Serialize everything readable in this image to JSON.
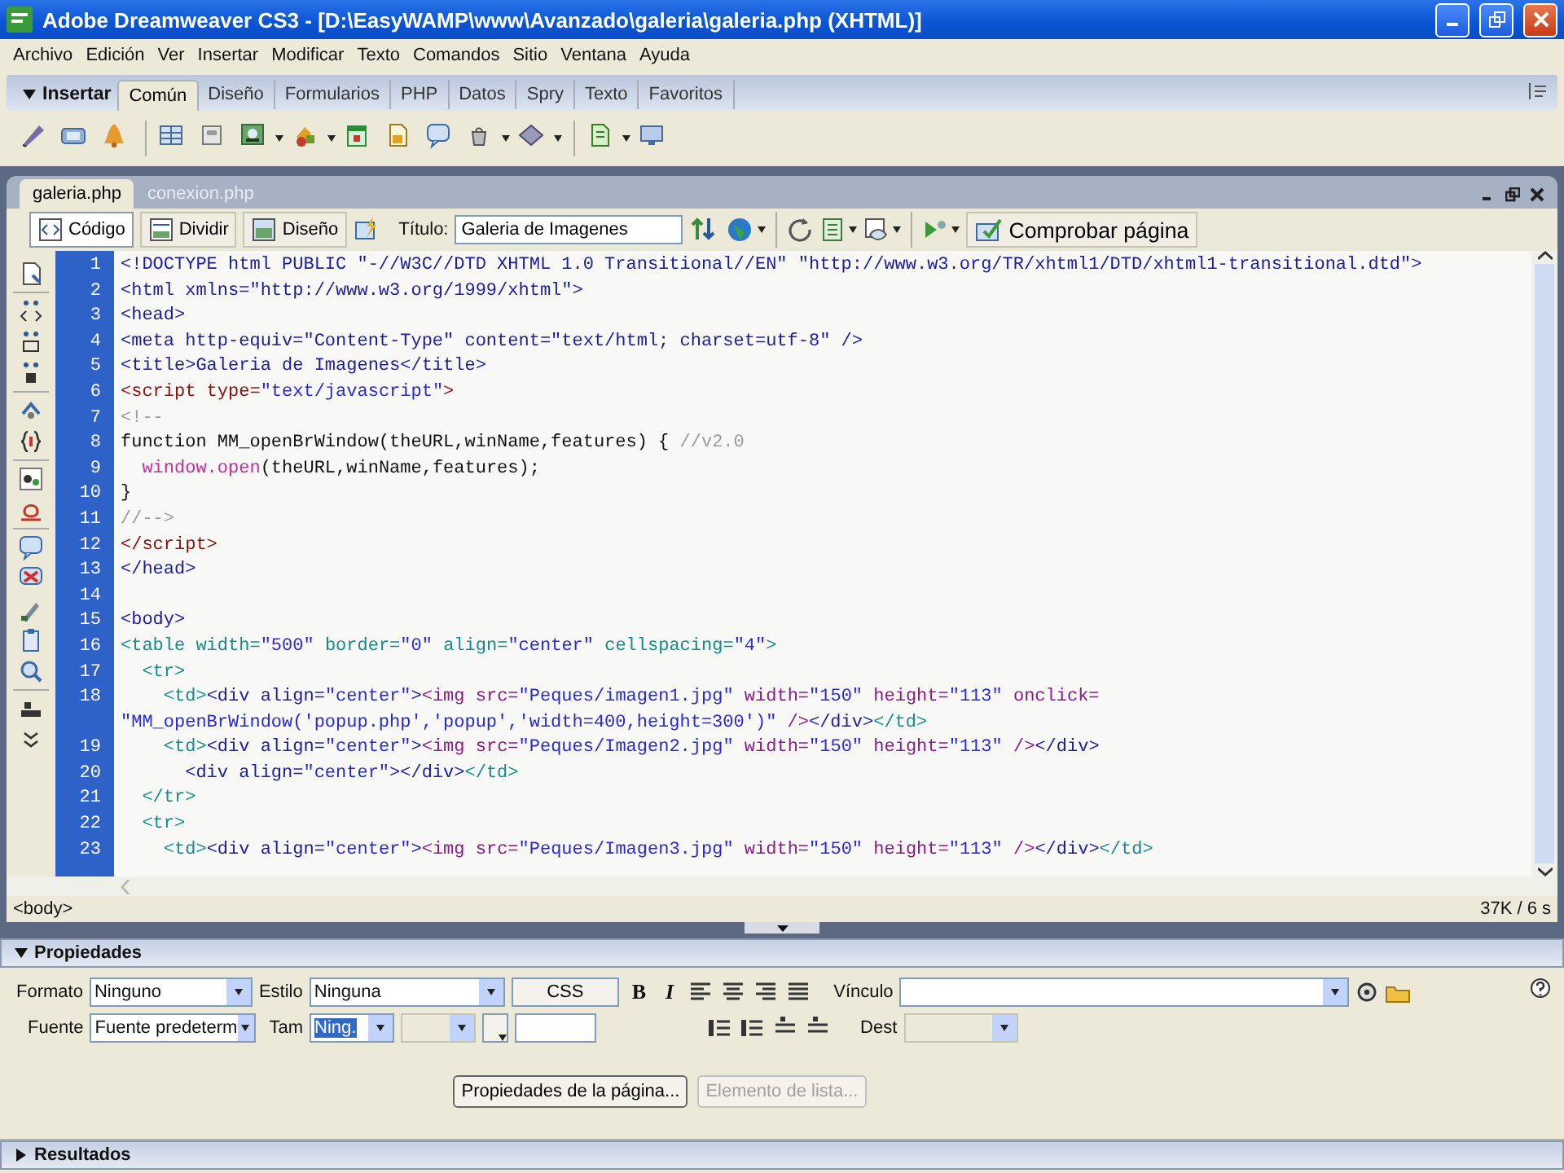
{
  "window": {
    "title": "Adobe Dreamweaver CS3 - [D:\\EasyWAMP\\www\\Avanzado\\galeria\\galeria.php (XHTML)]"
  },
  "menu": [
    "Archivo",
    "Edición",
    "Ver",
    "Insertar",
    "Modificar",
    "Texto",
    "Comandos",
    "Sitio",
    "Ventana",
    "Ayuda"
  ],
  "insert_bar": {
    "title": "Insertar",
    "expanded": true,
    "tabs": [
      {
        "label": "Común",
        "selected": true
      },
      {
        "label": "Diseño",
        "selected": false
      },
      {
        "label": "Formularios",
        "selected": false
      },
      {
        "label": "PHP",
        "selected": false
      },
      {
        "label": "Datos",
        "selected": false
      },
      {
        "label": "Spry",
        "selected": false
      },
      {
        "label": "Texto",
        "selected": false
      },
      {
        "label": "Favoritos",
        "selected": false
      }
    ]
  },
  "document_tabs": [
    {
      "label": "galeria.php",
      "selected": true
    },
    {
      "label": "conexion.php",
      "selected": false
    }
  ],
  "document_toolbar": {
    "views": [
      {
        "label": "Código",
        "selected": true
      },
      {
        "label": "Dividir",
        "selected": false
      },
      {
        "label": "Diseño",
        "selected": false
      }
    ],
    "title_label": "Título:",
    "title_value": "Galeria de Imagenes",
    "check_page": "Comprobar página"
  },
  "code": {
    "lines": [
      {
        "number": "1",
        "segments": [
          {
            "kind": "tag",
            "text": "<!DOCTYPE html PUBLIC \"-//W3C//DTD XHTML 1.0 Transitional//EN\" \"http://www.w3.org/TR/xhtml1/DTD/xhtml1-transitional.dtd\">"
          }
        ]
      },
      {
        "number": "2",
        "segments": [
          {
            "kind": "tag",
            "text": "<html xmlns=\"http://www.w3.org/1999/xhtml\">"
          }
        ]
      },
      {
        "number": "3",
        "segments": [
          {
            "kind": "tag",
            "text": "<head>"
          }
        ]
      },
      {
        "number": "4",
        "segments": [
          {
            "kind": "tag",
            "text": "<meta http-equiv=\"Content-Type\" content=\"text/html; charset=utf-8\" />"
          }
        ]
      },
      {
        "number": "5",
        "segments": [
          {
            "kind": "tag",
            "text": "<title>Galeria de Imagenes</title>"
          }
        ]
      },
      {
        "number": "6",
        "segments": [
          {
            "kind": "script",
            "text": "<script type="
          },
          {
            "kind": "value",
            "text": "\"text/javascript\""
          },
          {
            "kind": "script",
            "text": ">"
          }
        ]
      },
      {
        "number": "7",
        "segments": [
          {
            "kind": "comment",
            "text": "<!--"
          }
        ]
      },
      {
        "number": "8",
        "segments": [
          {
            "kind": "text",
            "text": "function MM_openBrWindow(theURL,winName,features) { "
          },
          {
            "kind": "comment",
            "text": "//v2.0"
          }
        ]
      },
      {
        "number": "9",
        "segments": [
          {
            "kind": "func",
            "text": "  window.open"
          },
          {
            "kind": "text",
            "text": "(theURL,winName,features);"
          }
        ]
      },
      {
        "number": "10",
        "segments": [
          {
            "kind": "text",
            "text": "}"
          }
        ]
      },
      {
        "number": "11",
        "segments": [
          {
            "kind": "comment",
            "text": "//-->"
          }
        ]
      },
      {
        "number": "12",
        "segments": [
          {
            "kind": "script",
            "text": "</script>"
          }
        ]
      },
      {
        "number": "13",
        "segments": [
          {
            "kind": "tag",
            "text": "</head>"
          }
        ]
      },
      {
        "number": "14"
      },
      {
        "number": "15",
        "segments": [
          {
            "kind": "tag",
            "text": "<body>"
          }
        ]
      },
      {
        "number": "16",
        "segments": [
          {
            "kind": "table",
            "text": "<table width="
          },
          {
            "kind": "value",
            "text": "\"500\""
          },
          {
            "kind": "table",
            "text": " border="
          },
          {
            "kind": "value",
            "text": "\"0\""
          },
          {
            "kind": "table",
            "text": " align="
          },
          {
            "kind": "value",
            "text": "\"center\""
          },
          {
            "kind": "table",
            "text": " cellspacing="
          },
          {
            "kind": "value",
            "text": "\"4\""
          },
          {
            "kind": "table",
            "text": ">"
          }
        ]
      },
      {
        "number": "17",
        "segments": [
          {
            "kind": "table",
            "text": "  <tr>"
          }
        ]
      },
      {
        "number": "18",
        "segments": [
          {
            "kind": "table",
            "text": "    <td>"
          },
          {
            "kind": "tag",
            "text": "<div align="
          },
          {
            "kind": "value",
            "text": "\"center\""
          },
          {
            "kind": "tag",
            "text": ">"
          },
          {
            "kind": "img",
            "text": "<img src="
          },
          {
            "kind": "value",
            "text": "\"Peques/imagen1.jpg\""
          },
          {
            "kind": "img",
            "text": " width="
          },
          {
            "kind": "value",
            "text": "\"150\""
          },
          {
            "kind": "img",
            "text": " height="
          },
          {
            "kind": "value",
            "text": "\"113\""
          },
          {
            "kind": "img",
            "text": " onclick="
          }
        ]
      },
      {
        "segments": [
          {
            "kind": "value",
            "text": "\"MM_openBrWindow('popup.php','popup','width=400,height=300')\""
          },
          {
            "kind": "img",
            "text": " />"
          },
          {
            "kind": "tag",
            "text": "</div>"
          },
          {
            "kind": "table",
            "text": "</td>"
          }
        ]
      },
      {
        "number": "19",
        "segments": [
          {
            "kind": "table",
            "text": "    <td>"
          },
          {
            "kind": "tag",
            "text": "<div align="
          },
          {
            "kind": "value",
            "text": "\"center\""
          },
          {
            "kind": "tag",
            "text": ">"
          },
          {
            "kind": "img",
            "text": "<img src="
          },
          {
            "kind": "value",
            "text": "\"Peques/Imagen2.jpg\""
          },
          {
            "kind": "img",
            "text": " width="
          },
          {
            "kind": "value",
            "text": "\"150\""
          },
          {
            "kind": "img",
            "text": " height="
          },
          {
            "kind": "value",
            "text": "\"113\""
          },
          {
            "kind": "img",
            "text": " />"
          },
          {
            "kind": "tag",
            "text": "</div>"
          }
        ]
      },
      {
        "number": "20",
        "segments": [
          {
            "kind": "tag",
            "text": "      <div align="
          },
          {
            "kind": "value",
            "text": "\"center\""
          },
          {
            "kind": "tag",
            "text": "></div>"
          },
          {
            "kind": "table",
            "text": "</td>"
          }
        ]
      },
      {
        "number": "21",
        "segments": [
          {
            "kind": "table",
            "text": "  </tr>"
          }
        ]
      },
      {
        "number": "22",
        "segments": [
          {
            "kind": "table",
            "text": "  <tr>"
          }
        ]
      },
      {
        "number": "23",
        "segments": [
          {
            "kind": "table",
            "text": "    <td>"
          },
          {
            "kind": "tag",
            "text": "<div align="
          },
          {
            "kind": "value",
            "text": "\"center\""
          },
          {
            "kind": "tag",
            "text": ">"
          },
          {
            "kind": "img",
            "text": "<img src="
          },
          {
            "kind": "value",
            "text": "\"Peques/Imagen3.jpg\""
          },
          {
            "kind": "img",
            "text": " width="
          },
          {
            "kind": "value",
            "text": "\"150\""
          },
          {
            "kind": "img",
            "text": " height="
          },
          {
            "kind": "value",
            "text": "\"113\""
          },
          {
            "kind": "img",
            "text": " />"
          },
          {
            "kind": "tag",
            "text": "</div>"
          },
          {
            "kind": "table",
            "text": "</td>"
          }
        ]
      }
    ]
  },
  "status_bar": {
    "tag": "<body>",
    "size": "37K / 6 s"
  },
  "properties": {
    "title": "Propiedades",
    "expanded": true,
    "format": {
      "label": "Formato",
      "value": "Ninguno"
    },
    "style": {
      "label": "Estilo",
      "value": "Ninguna"
    },
    "css_button": "CSS",
    "bold": "B",
    "italic": "I",
    "link": {
      "label": "Vínculo"
    },
    "font": {
      "label": "Fuente",
      "value": "Fuente predeterm"
    },
    "size": {
      "label": "Tam",
      "value": "Ning.",
      "highlighted": true
    },
    "target": {
      "label": "Dest"
    },
    "buttons": [
      {
        "label": "Propiedades de la página...",
        "disabled": false
      },
      {
        "label": "Elemento de lista...",
        "disabled": true
      }
    ]
  },
  "results": {
    "title": "Resultados",
    "expanded": false
  }
}
